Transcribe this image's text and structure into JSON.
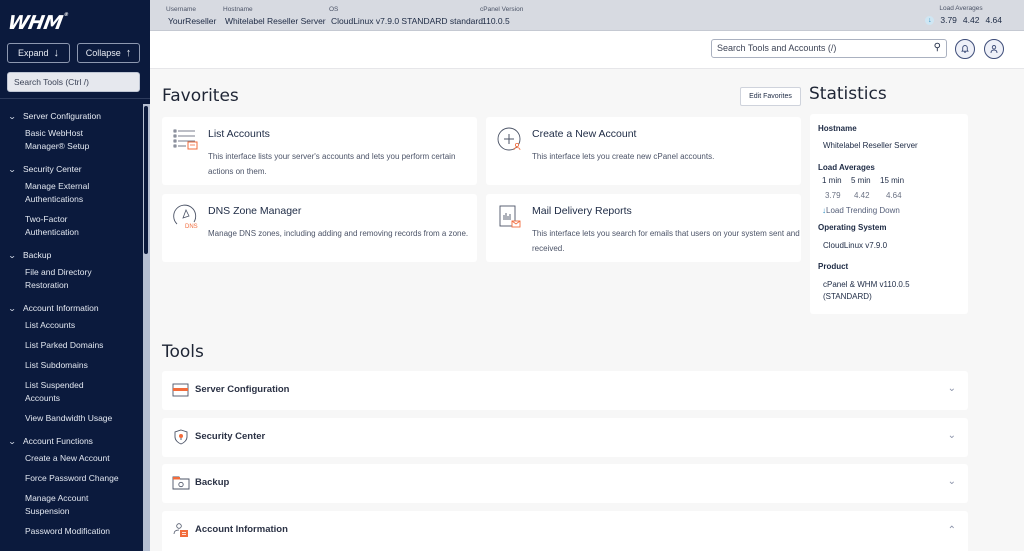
{
  "brand": {
    "logo": "WHM",
    "accent": "#f26c3c",
    "sidebar_bg": "#0b1a3d"
  },
  "sidebar": {
    "expand_label": "Expand",
    "collapse_label": "Collapse",
    "search_placeholder": "Search Tools (Ctrl /)",
    "groups": [
      {
        "label": "Server Configuration",
        "items": [
          "Basic WebHost Manager® Setup"
        ]
      },
      {
        "label": "Security Center",
        "items": [
          "Manage External Authentications",
          "Two-Factor Authentication"
        ]
      },
      {
        "label": "Backup",
        "items": [
          "File and Directory Restoration"
        ]
      },
      {
        "label": "Account Information",
        "items": [
          "List Accounts",
          "List Parked Domains",
          "List Subdomains",
          "List Suspended Accounts",
          "View Bandwidth Usage"
        ]
      },
      {
        "label": "Account Functions",
        "items": [
          "Create a New Account",
          "Force Password Change",
          "Manage Account Suspension",
          "Password Modification"
        ]
      }
    ]
  },
  "topbar": {
    "username_label": "Username",
    "username": "YourReseller",
    "hostname_label": "Hostname",
    "hostname": "Whitelabel Reseller Server",
    "os_label": "OS",
    "os": "CloudLinux v7.9.0 STANDARD standard",
    "cpanel_label": "cPanel Version",
    "cpanel_version": "110.0.5",
    "load_label": "Load Averages",
    "load": [
      "3.79",
      "4.42",
      "4.64"
    ]
  },
  "header": {
    "search_placeholder": "Search Tools and Accounts (/)"
  },
  "favorites": {
    "title": "Favorites",
    "edit_label": "Edit Favorites",
    "cards": [
      {
        "title": "List Accounts",
        "desc": "This interface lists your server's accounts and lets you perform certain actions on them.",
        "icon": "list-accounts-icon"
      },
      {
        "title": "Create a New Account",
        "desc": "This interface lets you create new cPanel accounts.",
        "icon": "create-account-icon"
      },
      {
        "title": "DNS Zone Manager",
        "desc": "Manage DNS zones, including adding and removing records from a zone.",
        "icon": "dns-icon"
      },
      {
        "title": "Mail Delivery Reports",
        "desc": "This interface lets you search for emails that users on your system sent and received.",
        "icon": "mail-report-icon"
      }
    ]
  },
  "statistics": {
    "title": "Statistics",
    "hostname_label": "Hostname",
    "hostname": "Whitelabel Reseller Server",
    "load_label": "Load Averages",
    "load_headers": [
      "1 min",
      "5 min",
      "15 min"
    ],
    "load_values": [
      "3.79",
      "4.42",
      "4.64"
    ],
    "trend": "Load Trending Down",
    "os_label": "Operating System",
    "os": "CloudLinux v7.9.0",
    "product_label": "Product",
    "product": "cPanel & WHM v110.0.5 (STANDARD)"
  },
  "tools": {
    "title": "Tools",
    "rows": [
      {
        "label": "Server Configuration",
        "expanded": false
      },
      {
        "label": "Security Center",
        "expanded": false
      },
      {
        "label": "Backup",
        "expanded": false
      },
      {
        "label": "Account Information",
        "expanded": true
      }
    ]
  }
}
